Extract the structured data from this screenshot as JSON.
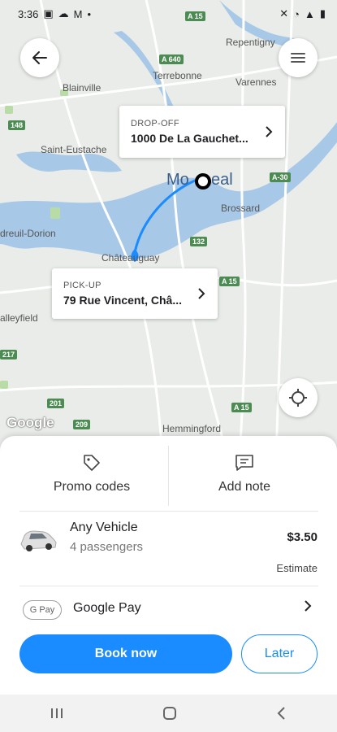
{
  "status_bar": {
    "time": "3:36",
    "notif_icons": [
      "image-icon",
      "cloud-icon",
      "gmail-icon",
      "dot-icon"
    ],
    "right_icons": [
      "mute-icon",
      "wifi-icon",
      "signal-icon",
      "battery-icon"
    ]
  },
  "map": {
    "city_name_left": "Mo",
    "city_name_right": "eal",
    "labels": {
      "repentigny": "Repentigny",
      "terrebonne": "Terrebonne",
      "varennes": "Varennes",
      "blainville": "Blainville",
      "saint_eustache": "Saint-Eustache",
      "brossard": "Brossard",
      "dreuil_dorion": "dreuil-Dorion",
      "chateauguay": "Châteauguay",
      "valleyfield": "alleyfield",
      "hemmingford": "Hemmingford"
    },
    "shields": {
      "a640": "A 640",
      "a15_top": "A 15",
      "a30": "A-30",
      "s148": "148",
      "s132": "132",
      "a15_mid": "A 15",
      "s201": "201",
      "s209": "209",
      "a15_bottom": "A 15",
      "s217": "217"
    },
    "google_logo": "Google"
  },
  "dropoff": {
    "label": "DROP-OFF",
    "address": "1000 De La Gauchet..."
  },
  "pickup": {
    "label": "PICK-UP",
    "address": "79 Rue Vincent, Châ..."
  },
  "sheet": {
    "promo_label": "Promo codes",
    "note_label": "Add note",
    "vehicle_name": "Any Vehicle",
    "vehicle_sub": "4 passengers",
    "price": "$3.50",
    "estimate": "Estimate",
    "gpay_badge": "G Pay",
    "payment_name": "Google Pay",
    "book_label": "Book now",
    "later_label": "Later"
  },
  "colors": {
    "accent": "#1a8cff",
    "water": "#a8c8e8",
    "map_bg": "#e9ece8"
  }
}
